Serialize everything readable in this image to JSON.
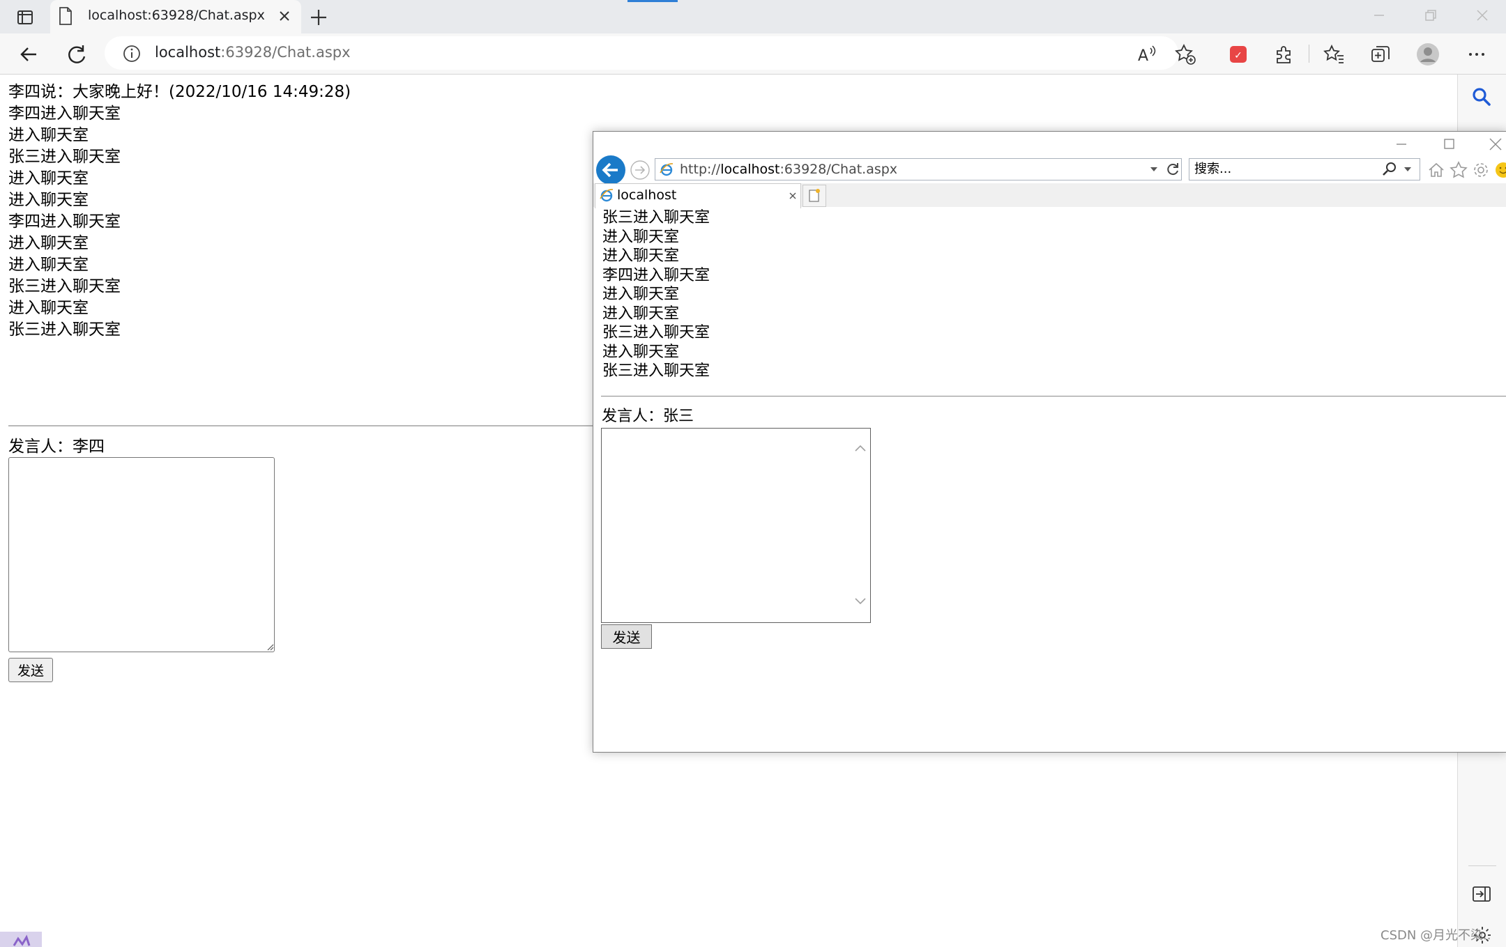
{
  "edge": {
    "tab": {
      "title": "localhost:63928/Chat.aspx"
    },
    "address": {
      "host": "localhost",
      "rest": ":63928/Chat.aspx"
    },
    "toolbar_icons": [
      "read-aloud-icon",
      "add-favorite-icon",
      "extension-red-icon",
      "extensions-icon",
      "favorites-icon",
      "collections-icon",
      "profile-icon",
      "more-icon"
    ],
    "page": {
      "messages": [
        "李四说：大家晚上好！(2022/10/16 14:49:28)",
        "李四进入聊天室",
        "进入聊天室",
        "张三进入聊天室",
        "进入聊天室",
        "进入聊天室",
        "李四进入聊天室",
        "进入聊天室",
        "进入聊天室",
        "张三进入聊天室",
        "进入聊天室",
        "张三进入聊天室"
      ],
      "speaker": "发言人：李四",
      "message_input": "",
      "send_label": "发送"
    }
  },
  "ie": {
    "address": {
      "prefix": "http://",
      "host": "localhost",
      "rest": ":63928/Chat.aspx"
    },
    "search_placeholder": "搜索...",
    "tab": {
      "title": "localhost"
    },
    "page": {
      "messages": [
        "张三进入聊天室",
        "进入聊天室",
        "进入聊天室",
        "李四进入聊天室",
        "进入聊天室",
        "进入聊天室",
        "张三进入聊天室",
        "进入聊天室",
        "张三进入聊天室"
      ],
      "speaker": "发言人：张三",
      "message_input": "",
      "send_label": "发送"
    }
  },
  "watermark": "CSDN @月光不染..",
  "colors": {
    "edge_chrome": "#f7f7f7",
    "edge_tabbar": "#e8eaed",
    "ie_back_button": "#1a7ac8",
    "sidebar_search": "#1f5bd6"
  }
}
